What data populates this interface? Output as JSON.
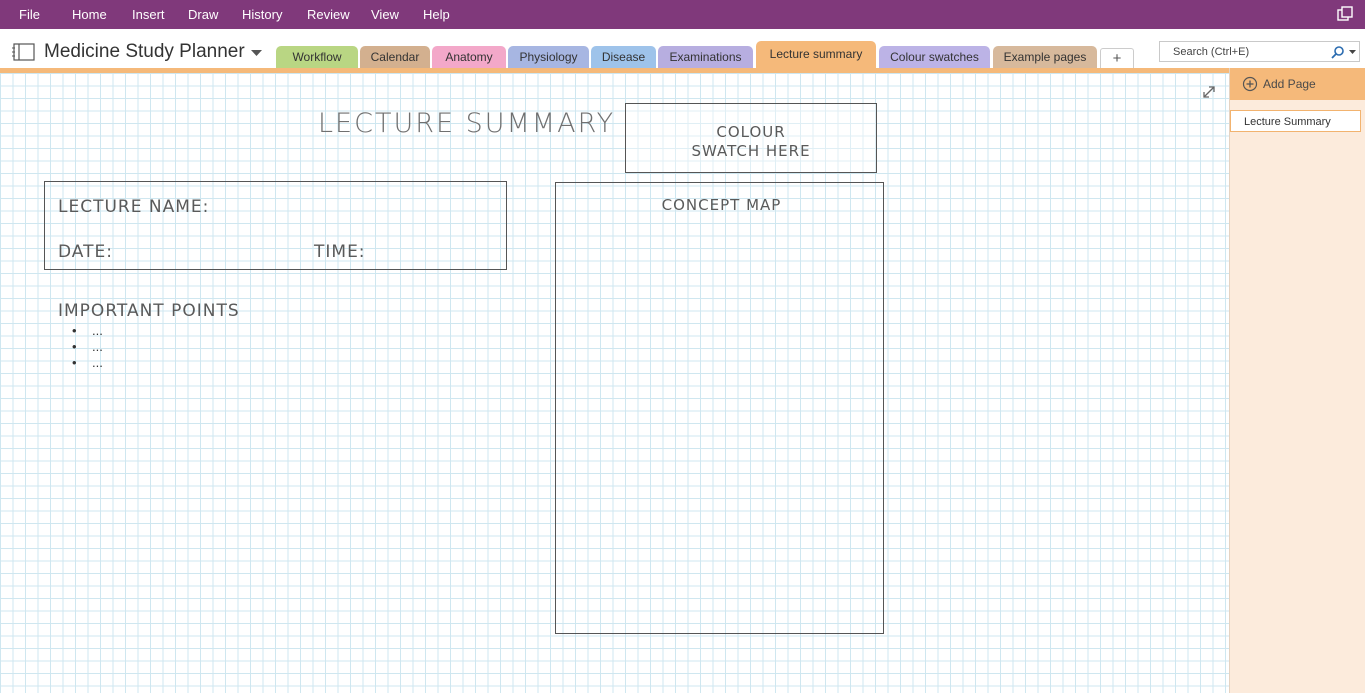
{
  "menu": {
    "items": [
      "File",
      "Home",
      "Insert",
      "Draw",
      "History",
      "Review",
      "View",
      "Help"
    ]
  },
  "notebook": {
    "title": "Medicine Study Planner"
  },
  "tabs": [
    {
      "label": "Workflow",
      "color": "#b9d683"
    },
    {
      "label": "Calendar",
      "color": "#d3b08f"
    },
    {
      "label": "Anatomy",
      "color": "#f3a8c9"
    },
    {
      "label": "Physiology",
      "color": "#a7b6e2"
    },
    {
      "label": "Disease",
      "color": "#9ec3ea"
    },
    {
      "label": "Examinations",
      "color": "#b7aee0"
    },
    {
      "label": "Lecture summary",
      "color": "#f5b97a"
    },
    {
      "label": "Colour swatches",
      "color": "#bcb3e6"
    },
    {
      "label": "Example pages",
      "color": "#d7b99c"
    }
  ],
  "tab_add_label": "+",
  "search": {
    "placeholder": "Search (Ctrl+E)"
  },
  "page": {
    "title": "LECTURE SUMMARY",
    "swatch_line1": "COLOUR",
    "swatch_line2": "SWATCH HERE",
    "lecture_name_label": "LECTURE NAME:",
    "date_label": "DATE:",
    "time_label": "TIME:",
    "important_points_title": "IMPORTANT POINTS",
    "points": [
      "...",
      "...",
      "..."
    ],
    "concept_map_title": "CONCEPT MAP"
  },
  "pages_pane": {
    "add_page_label": "Add Page",
    "pages": [
      "Lecture Summary"
    ]
  },
  "colors": {
    "ribbon": "#80397b",
    "active_section": "#f5b97a",
    "pane_background": "#fcebdc",
    "grid_line": "#cfe7f0"
  }
}
